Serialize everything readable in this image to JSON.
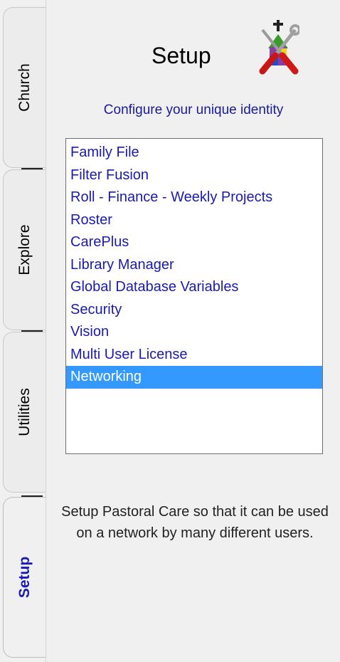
{
  "tabs": [
    {
      "label": "Church",
      "active": false
    },
    {
      "label": "Explore",
      "active": false
    },
    {
      "label": "Utilities",
      "active": false
    },
    {
      "label": "Setup",
      "active": true
    }
  ],
  "header": {
    "title": "Setup",
    "icon": "tools-icon",
    "subtitle": "Configure your unique identity"
  },
  "list": {
    "items": [
      "Family File",
      "Filter Fusion",
      "Roll - Finance - Weekly Projects",
      "Roster",
      "CarePlus",
      "Library Manager",
      "Global Database Variables",
      "Security",
      "Vision",
      "Multi User License",
      "Networking"
    ],
    "selected": "Networking"
  },
  "description": "Setup Pastoral Care so that it can be used on a network by many different users.",
  "colors": {
    "selection": "#3399ff",
    "item_text": "#1a1ab0",
    "subtitle": "#1a1a9a",
    "active_tab": "#1a1ab8"
  }
}
